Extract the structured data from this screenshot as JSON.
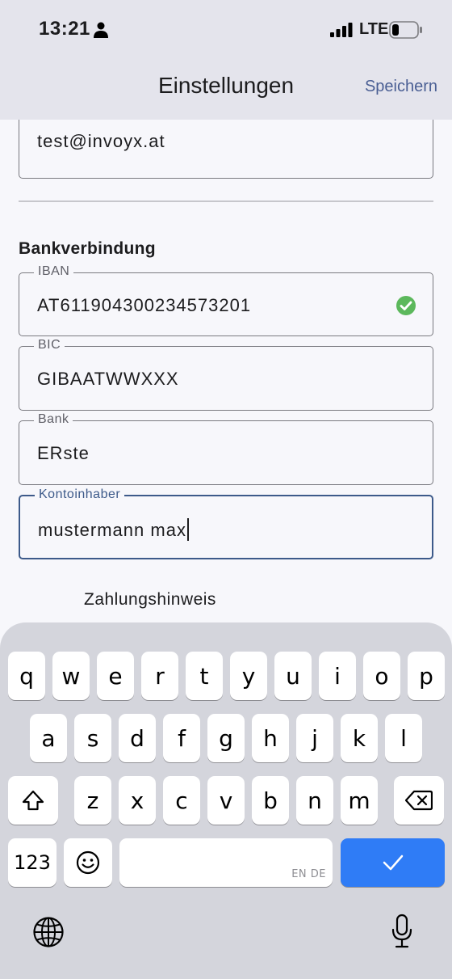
{
  "status": {
    "time": "13:21",
    "network": "LTE"
  },
  "nav": {
    "title": "Einstellungen",
    "save": "Speichern"
  },
  "email_field": {
    "value": "test@invoyx.at"
  },
  "bank_section": {
    "title": "Bankverbindung",
    "iban": {
      "label": "IBAN",
      "value": "AT611904300234573201",
      "valid": true
    },
    "bic": {
      "label": "BIC",
      "value": "GIBAATWWXXX"
    },
    "bank": {
      "label": "Bank",
      "value": "ERste"
    },
    "holder": {
      "label": "Kontoinhaber",
      "value": "mustermann max"
    }
  },
  "payment_hint": {
    "label": "Zahlungshinweis"
  },
  "keyboard": {
    "row1": [
      "q",
      "w",
      "e",
      "r",
      "t",
      "y",
      "u",
      "i",
      "o",
      "p"
    ],
    "row2": [
      "a",
      "s",
      "d",
      "f",
      "g",
      "h",
      "j",
      "k",
      "l"
    ],
    "row3": [
      "z",
      "x",
      "c",
      "v",
      "b",
      "n",
      "m"
    ],
    "numbers_key": "123",
    "emoji_key": "☺",
    "space_lang": "EN DE",
    "done_key": "✓",
    "shift_icon": "shift-icon",
    "delete_icon": "backspace-icon"
  },
  "colors": {
    "accent": "#3d5a8a",
    "link": "#4a5f94",
    "valid": "#5cb85c",
    "done_key": "#2f7cf6"
  }
}
